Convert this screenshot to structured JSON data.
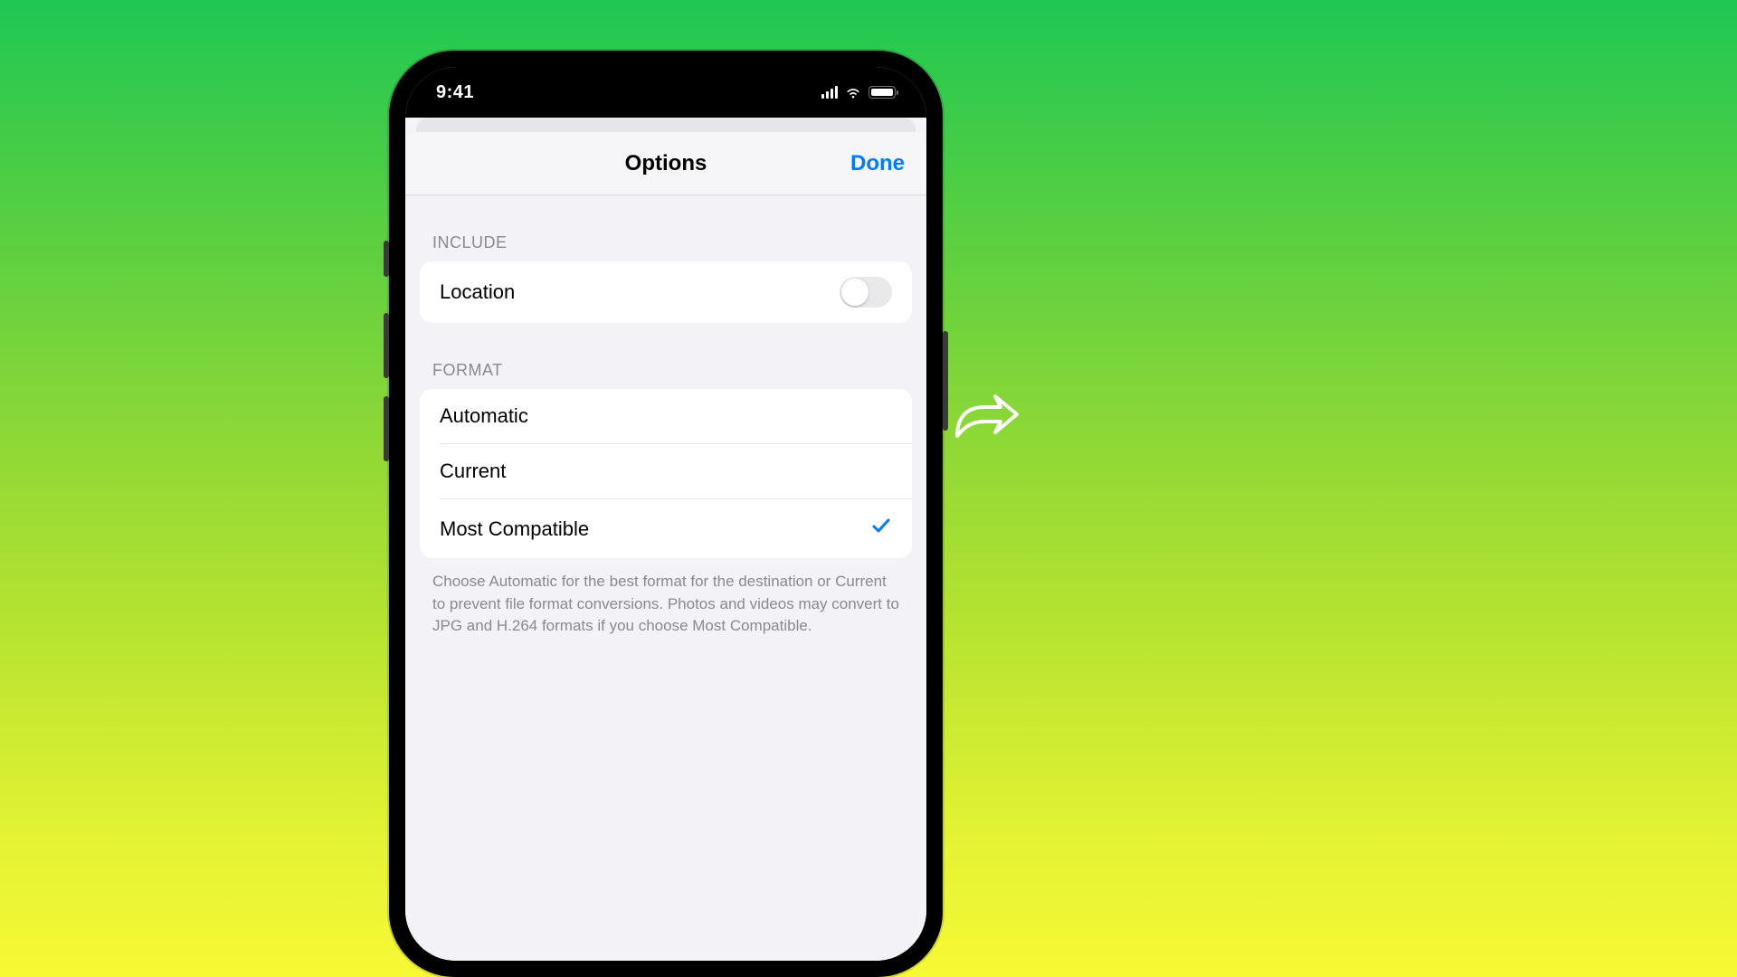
{
  "status_bar": {
    "time": "9:41"
  },
  "nav": {
    "title": "Options",
    "done": "Done"
  },
  "sections": {
    "include": {
      "header": "INCLUDE",
      "location_label": "Location",
      "location_on": false
    },
    "format": {
      "header": "FORMAT",
      "options": {
        "automatic": "Automatic",
        "current": "Current",
        "most_compatible": "Most Compatible"
      },
      "selected": "most_compatible",
      "footer": "Choose Automatic for the best format for the destination or Current to prevent file format conversions. Photos and videos may convert to JPG and H.264 formats if you choose Most Compatible."
    }
  }
}
